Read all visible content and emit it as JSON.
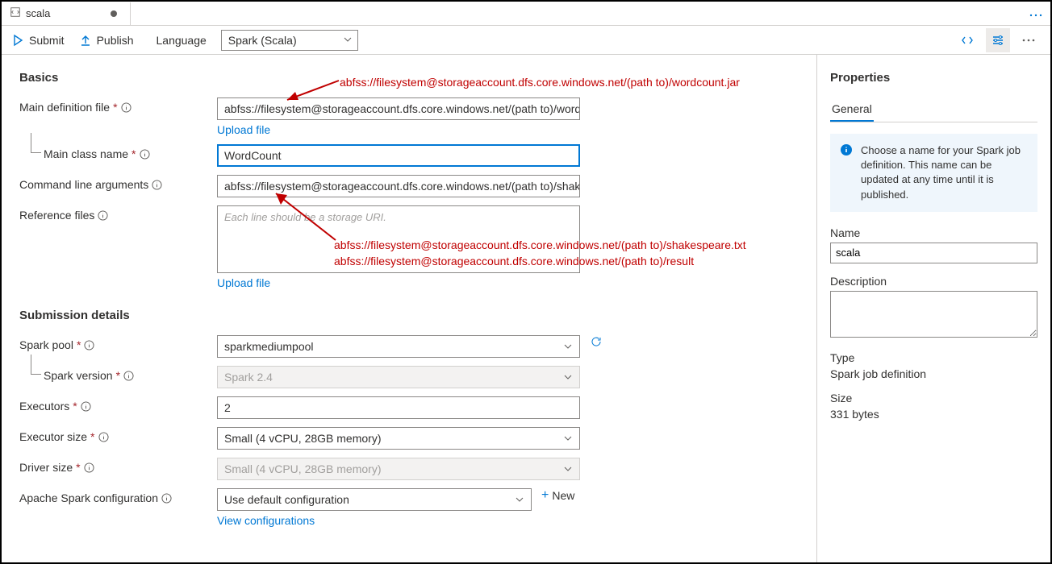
{
  "tab": {
    "title": "scala"
  },
  "toolbar": {
    "submit": "Submit",
    "publish": "Publish",
    "language_label": "Language",
    "language_value": "Spark (Scala)"
  },
  "basics": {
    "heading": "Basics",
    "main_def_label": "Main definition file",
    "main_def_value": "abfss://filesystem@storageaccount.dfs.core.windows.net/(path to)/wordc...",
    "upload_file": "Upload file",
    "main_class_label": "Main class name",
    "main_class_value": "WordCount",
    "cmd_args_label": "Command line arguments",
    "cmd_args_value": "abfss://filesystem@storageaccount.dfs.core.windows.net/(path to)/shakes...",
    "ref_files_label": "Reference files",
    "ref_files_placeholder": "Each line should be a storage URI."
  },
  "submission": {
    "heading": "Submission details",
    "spark_pool_label": "Spark pool",
    "spark_pool_value": "sparkmediumpool",
    "spark_version_label": "Spark version",
    "spark_version_value": "Spark 2.4",
    "executors_label": "Executors",
    "executors_value": "2",
    "executor_size_label": "Executor size",
    "executor_size_value": "Small (4 vCPU, 28GB memory)",
    "driver_size_label": "Driver size",
    "driver_size_value": "Small (4 vCPU, 28GB memory)",
    "config_label": "Apache Spark configuration",
    "config_value": "Use default configuration",
    "new": "New",
    "view_config": "View configurations"
  },
  "annotations": {
    "a1": "abfss://filesystem@storageaccount.dfs.core.windows.net/(path to)/wordcount.jar",
    "a2": "abfss://filesystem@storageaccount.dfs.core.windows.net/(path to)/shakespeare.txt",
    "a3": "abfss://filesystem@storageaccount.dfs.core.windows.net/(path to)/result"
  },
  "properties": {
    "heading": "Properties",
    "tab_general": "General",
    "info": "Choose a name for your Spark job definition. This name can be updated at any time until it is published.",
    "name_label": "Name",
    "name_value": "scala",
    "description_label": "Description",
    "type_label": "Type",
    "type_value": "Spark job definition",
    "size_label": "Size",
    "size_value": "331 bytes"
  }
}
